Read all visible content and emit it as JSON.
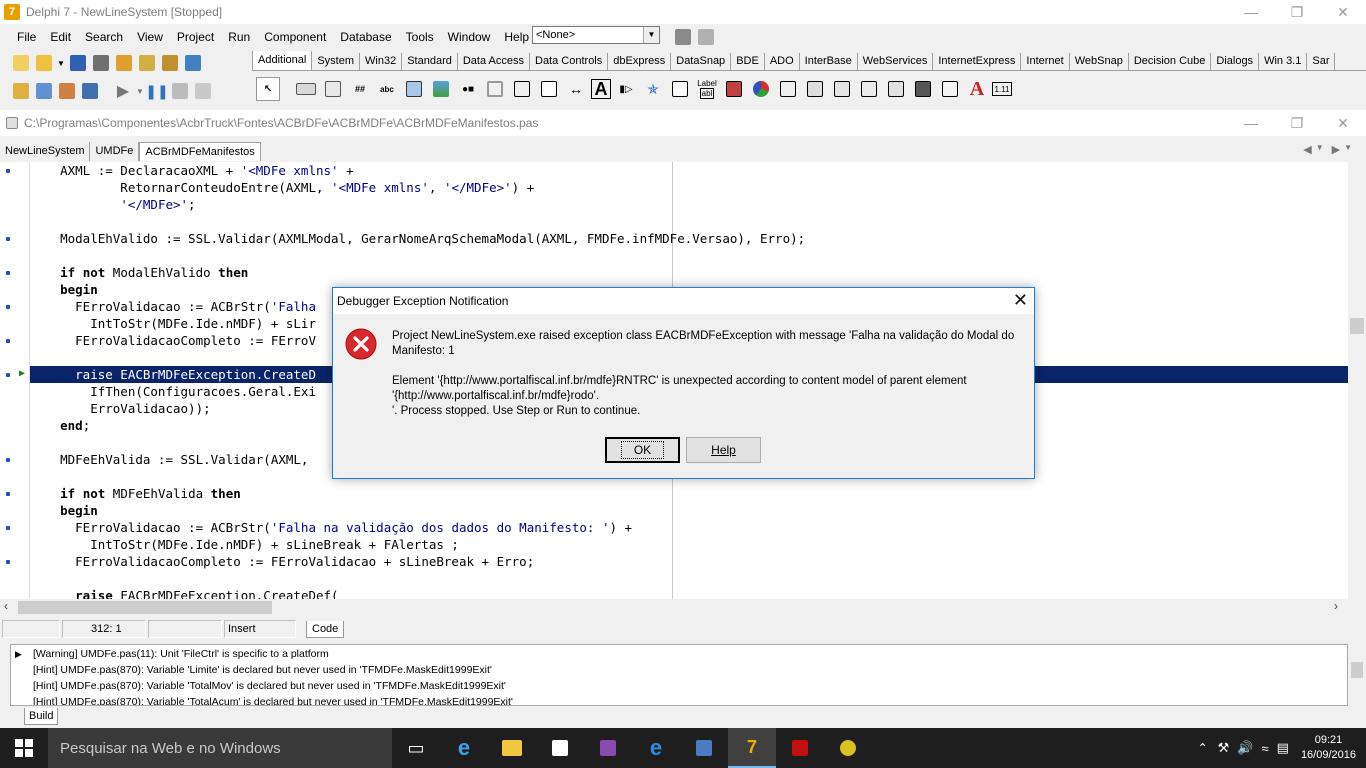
{
  "window": {
    "title": "Delphi 7 - NewLineSystem [Stopped]",
    "app_icon_letter": "7"
  },
  "menu": [
    "File",
    "Edit",
    "Search",
    "View",
    "Project",
    "Run",
    "Component",
    "Database",
    "Tools",
    "Window",
    "Help"
  ],
  "target_combo": {
    "value": "<None>"
  },
  "palette": {
    "tabs": [
      "Additional",
      "System",
      "Win32",
      "Standard",
      "Data Access",
      "Data Controls",
      "dbExpress",
      "DataSnap",
      "BDE",
      "ADO",
      "InterBase",
      "WebServices",
      "InternetExpress",
      "Internet",
      "WebSnap",
      "Decision Cube",
      "Dialogs",
      "Win 3.1",
      "Sar"
    ],
    "active_tab": "Additional",
    "component_labels": {
      "label_icon_top": "Label",
      "label_icon_bottom": "abl",
      "version_icon": "1.11"
    }
  },
  "editor": {
    "file_path": "C:\\Programas\\Componentes\\AcbrTruck\\Fontes\\ACBrDFe\\ACBrMDFe\\ACBrMDFeManifestos.pas",
    "tabs": [
      "NewLineSystem",
      "UMDFe",
      "ACBrMDFeManifestos"
    ],
    "active_tab": "ACBrMDFeManifestos"
  },
  "code_lines": [
    {
      "text": "    AXML := DeclaracaoXML + '<MDFe xmlns' +",
      "dot": true
    },
    {
      "text": "            RetornarConteudoEntre(AXML, '<MDFe xmlns', '</MDFe>') +",
      "dot": false
    },
    {
      "text": "            '</MDFe>';",
      "dot": false
    },
    {
      "text": "",
      "dot": false
    },
    {
      "text": "    ModalEhValido := SSL.Validar(AXMLModal, GerarNomeArqSchemaModal(AXML, FMDFe.infMDFe.Versao), Erro);",
      "dot": true
    },
    {
      "text": "",
      "dot": false
    },
    {
      "text": "    if not ModalEhValido then",
      "dot": true
    },
    {
      "text": "    begin",
      "dot": false
    },
    {
      "text": "      FErroValidacao := ACBrStr('Falha",
      "dot": true
    },
    {
      "text": "        IntToStr(MDFe.Ide.nMDF) + sLir",
      "dot": false
    },
    {
      "text": "      FErroValidacaoCompleto := FErroV",
      "dot": true
    },
    {
      "text": "",
      "dot": false
    },
    {
      "text": "      raise EACBrMDFeException.CreateD",
      "dot": false,
      "exec": true
    },
    {
      "text": "        IfThen(Configuracoes.Geral.Exi",
      "dot": false
    },
    {
      "text": "        ErroValidacao));",
      "dot": false
    },
    {
      "text": "    end;",
      "dot": false
    },
    {
      "text": "",
      "dot": false
    },
    {
      "text": "    MDFeEhValida := SSL.Validar(AXML,",
      "dot": true
    },
    {
      "text": "",
      "dot": false
    },
    {
      "text": "    if not MDFeEhValida then",
      "dot": true
    },
    {
      "text": "    begin",
      "dot": false
    },
    {
      "text": "      FErroValidacao := ACBrStr('Falha na validação dos dados do Manifesto: ') +",
      "dot": true
    },
    {
      "text": "        IntToStr(MDFe.Ide.nMDF) + sLineBreak + FAlertas ;",
      "dot": false
    },
    {
      "text": "      FErroValidacaoCompleto := FErroValidacao + sLineBreak + Erro;",
      "dot": true
    },
    {
      "text": "",
      "dot": false
    },
    {
      "text": "      raise EACBrMDFeException.CreateDef(",
      "dot": false
    }
  ],
  "status": {
    "position": "312:   1",
    "mode": "Insert",
    "view_tab": "Code"
  },
  "messages": [
    "[Warning] UMDFe.pas(11): Unit 'FileCtrl' is specific to a platform",
    "[Hint] UMDFe.pas(870): Variable 'Limite' is declared but never used in 'TFMDFe.MaskEdit1999Exit'",
    "[Hint] UMDFe.pas(870): Variable 'TotalMov' is declared but never used in 'TFMDFe.MaskEdit1999Exit'",
    "[Hint] UMDFe.pas(870): Variable 'TotalAcum' is declared but never used in 'TFMDFe.MaskEdit1999Exit'"
  ],
  "messages_tab": "Build",
  "dialog": {
    "title": "Debugger Exception Notification",
    "line1": "Project NewLineSystem.exe raised exception class EACBrMDFeException with message 'Falha na validação do Modal do Manifesto: 1",
    "line2": "Element '{http://www.portalfiscal.inf.br/mdfe}RNTRC' is unexpected according to content model of parent element '{http://www.portalfiscal.inf.br/mdfe}rodo'.",
    "line3": "'. Process stopped. Use Step or Run to continue.",
    "ok_label": "OK",
    "help_label": "Help"
  },
  "taskbar": {
    "search_placeholder": "Pesquisar na Web e no Windows",
    "time": "09:21",
    "date": "16/09/2016"
  },
  "colors": {
    "exec_line_bg": "#0a246a",
    "string_literal": "#00008b",
    "taskbar_bg": "#1e1e1e"
  }
}
